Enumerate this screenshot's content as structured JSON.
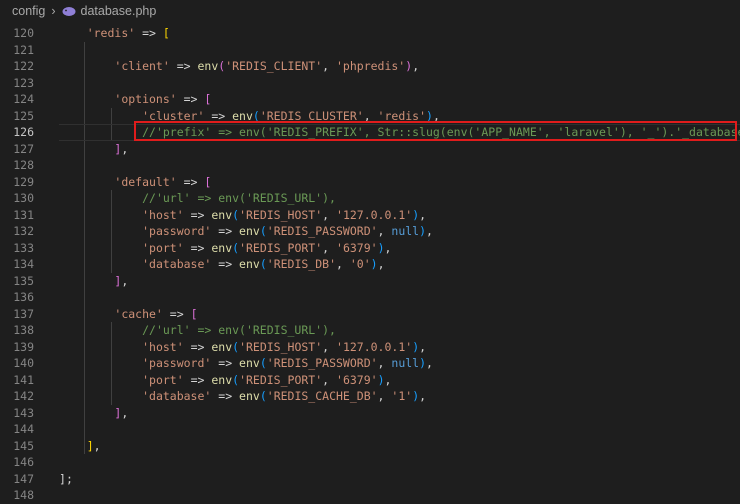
{
  "breadcrumb": {
    "folder": "config",
    "file": "database.php"
  },
  "lines": [
    {
      "num": "120",
      "tokens": [
        [
          "t",
          "    "
        ],
        [
          "s",
          "'redis'"
        ],
        [
          "t",
          " => "
        ],
        [
          "b1",
          "["
        ]
      ]
    },
    {
      "num": "121",
      "tokens": []
    },
    {
      "num": "122",
      "tokens": [
        [
          "t",
          "        "
        ],
        [
          "s",
          "'client'"
        ],
        [
          "t",
          " => "
        ],
        [
          "f",
          "env"
        ],
        [
          "b2",
          "("
        ],
        [
          "s",
          "'REDIS_CLIENT'"
        ],
        [
          "t",
          ", "
        ],
        [
          "s",
          "'phpredis'"
        ],
        [
          "b2",
          ")"
        ],
        [
          "t",
          ","
        ]
      ]
    },
    {
      "num": "123",
      "tokens": []
    },
    {
      "num": "124",
      "tokens": [
        [
          "t",
          "        "
        ],
        [
          "s",
          "'options'"
        ],
        [
          "t",
          " => "
        ],
        [
          "b2",
          "["
        ]
      ]
    },
    {
      "num": "125",
      "tokens": [
        [
          "t",
          "            "
        ],
        [
          "s",
          "'cluster'"
        ],
        [
          "t",
          " => "
        ],
        [
          "f",
          "env"
        ],
        [
          "b3",
          "("
        ],
        [
          "s",
          "'REDIS_CLUSTER'"
        ],
        [
          "t",
          ", "
        ],
        [
          "s",
          "'redis'"
        ],
        [
          "b3",
          ")"
        ],
        [
          "t",
          ","
        ]
      ]
    },
    {
      "num": "126",
      "tokens": [
        [
          "t",
          "            "
        ],
        [
          "c",
          "//'prefix' => env('REDIS_PREFIX', Str::slug(env('APP_NAME', 'laravel'), '_').'_database_'),"
        ]
      ]
    },
    {
      "num": "127",
      "tokens": [
        [
          "t",
          "        "
        ],
        [
          "b2",
          "]"
        ],
        [
          "t",
          ","
        ]
      ]
    },
    {
      "num": "128",
      "tokens": []
    },
    {
      "num": "129",
      "tokens": [
        [
          "t",
          "        "
        ],
        [
          "s",
          "'default'"
        ],
        [
          "t",
          " => "
        ],
        [
          "b2",
          "["
        ]
      ]
    },
    {
      "num": "130",
      "tokens": [
        [
          "t",
          "            "
        ],
        [
          "c",
          "//'url' => env('REDIS_URL'),"
        ]
      ]
    },
    {
      "num": "131",
      "tokens": [
        [
          "t",
          "            "
        ],
        [
          "s",
          "'host'"
        ],
        [
          "t",
          " => "
        ],
        [
          "f",
          "env"
        ],
        [
          "b3",
          "("
        ],
        [
          "s",
          "'REDIS_HOST'"
        ],
        [
          "t",
          ", "
        ],
        [
          "s",
          "'127.0.0.1'"
        ],
        [
          "b3",
          ")"
        ],
        [
          "t",
          ","
        ]
      ]
    },
    {
      "num": "132",
      "tokens": [
        [
          "t",
          "            "
        ],
        [
          "s",
          "'password'"
        ],
        [
          "t",
          " => "
        ],
        [
          "f",
          "env"
        ],
        [
          "b3",
          "("
        ],
        [
          "s",
          "'REDIS_PASSWORD'"
        ],
        [
          "t",
          ", "
        ],
        [
          "k",
          "null"
        ],
        [
          "b3",
          ")"
        ],
        [
          "t",
          ","
        ]
      ]
    },
    {
      "num": "133",
      "tokens": [
        [
          "t",
          "            "
        ],
        [
          "s",
          "'port'"
        ],
        [
          "t",
          " => "
        ],
        [
          "f",
          "env"
        ],
        [
          "b3",
          "("
        ],
        [
          "s",
          "'REDIS_PORT'"
        ],
        [
          "t",
          ", "
        ],
        [
          "s",
          "'6379'"
        ],
        [
          "b3",
          ")"
        ],
        [
          "t",
          ","
        ]
      ]
    },
    {
      "num": "134",
      "tokens": [
        [
          "t",
          "            "
        ],
        [
          "s",
          "'database'"
        ],
        [
          "t",
          " => "
        ],
        [
          "f",
          "env"
        ],
        [
          "b3",
          "("
        ],
        [
          "s",
          "'REDIS_DB'"
        ],
        [
          "t",
          ", "
        ],
        [
          "s",
          "'0'"
        ],
        [
          "b3",
          ")"
        ],
        [
          "t",
          ","
        ]
      ]
    },
    {
      "num": "135",
      "tokens": [
        [
          "t",
          "        "
        ],
        [
          "b2",
          "]"
        ],
        [
          "t",
          ","
        ]
      ]
    },
    {
      "num": "136",
      "tokens": []
    },
    {
      "num": "137",
      "tokens": [
        [
          "t",
          "        "
        ],
        [
          "s",
          "'cache'"
        ],
        [
          "t",
          " => "
        ],
        [
          "b2",
          "["
        ]
      ]
    },
    {
      "num": "138",
      "tokens": [
        [
          "t",
          "            "
        ],
        [
          "c",
          "//'url' => env('REDIS_URL'),"
        ]
      ]
    },
    {
      "num": "139",
      "tokens": [
        [
          "t",
          "            "
        ],
        [
          "s",
          "'host'"
        ],
        [
          "t",
          " => "
        ],
        [
          "f",
          "env"
        ],
        [
          "b3",
          "("
        ],
        [
          "s",
          "'REDIS_HOST'"
        ],
        [
          "t",
          ", "
        ],
        [
          "s",
          "'127.0.0.1'"
        ],
        [
          "b3",
          ")"
        ],
        [
          "t",
          ","
        ]
      ]
    },
    {
      "num": "140",
      "tokens": [
        [
          "t",
          "            "
        ],
        [
          "s",
          "'password'"
        ],
        [
          "t",
          " => "
        ],
        [
          "f",
          "env"
        ],
        [
          "b3",
          "("
        ],
        [
          "s",
          "'REDIS_PASSWORD'"
        ],
        [
          "t",
          ", "
        ],
        [
          "k",
          "null"
        ],
        [
          "b3",
          ")"
        ],
        [
          "t",
          ","
        ]
      ]
    },
    {
      "num": "141",
      "tokens": [
        [
          "t",
          "            "
        ],
        [
          "s",
          "'port'"
        ],
        [
          "t",
          " => "
        ],
        [
          "f",
          "env"
        ],
        [
          "b3",
          "("
        ],
        [
          "s",
          "'REDIS_PORT'"
        ],
        [
          "t",
          ", "
        ],
        [
          "s",
          "'6379'"
        ],
        [
          "b3",
          ")"
        ],
        [
          "t",
          ","
        ]
      ]
    },
    {
      "num": "142",
      "tokens": [
        [
          "t",
          "            "
        ],
        [
          "s",
          "'database'"
        ],
        [
          "t",
          " => "
        ],
        [
          "f",
          "env"
        ],
        [
          "b3",
          "("
        ],
        [
          "s",
          "'REDIS_CACHE_DB'"
        ],
        [
          "t",
          ", "
        ],
        [
          "s",
          "'1'"
        ],
        [
          "b3",
          ")"
        ],
        [
          "t",
          ","
        ]
      ]
    },
    {
      "num": "143",
      "tokens": [
        [
          "t",
          "        "
        ],
        [
          "b2",
          "]"
        ],
        [
          "t",
          ","
        ]
      ]
    },
    {
      "num": "144",
      "tokens": []
    },
    {
      "num": "145",
      "tokens": [
        [
          "t",
          "    "
        ],
        [
          "b1",
          "]"
        ],
        [
          "t",
          ","
        ]
      ]
    },
    {
      "num": "146",
      "tokens": []
    },
    {
      "num": "147",
      "tokens": [
        [
          "b0",
          "]"
        ],
        [
          "t",
          ";"
        ]
      ]
    },
    {
      "num": "148",
      "tokens": []
    }
  ],
  "active_line": "126",
  "colors": {
    "background": "#1e1e1e",
    "string": "#ce9178",
    "function": "#dcdcaa",
    "keyword": "#569cd6",
    "comment": "#6a9955",
    "highlight_box": "#e01c1c"
  }
}
